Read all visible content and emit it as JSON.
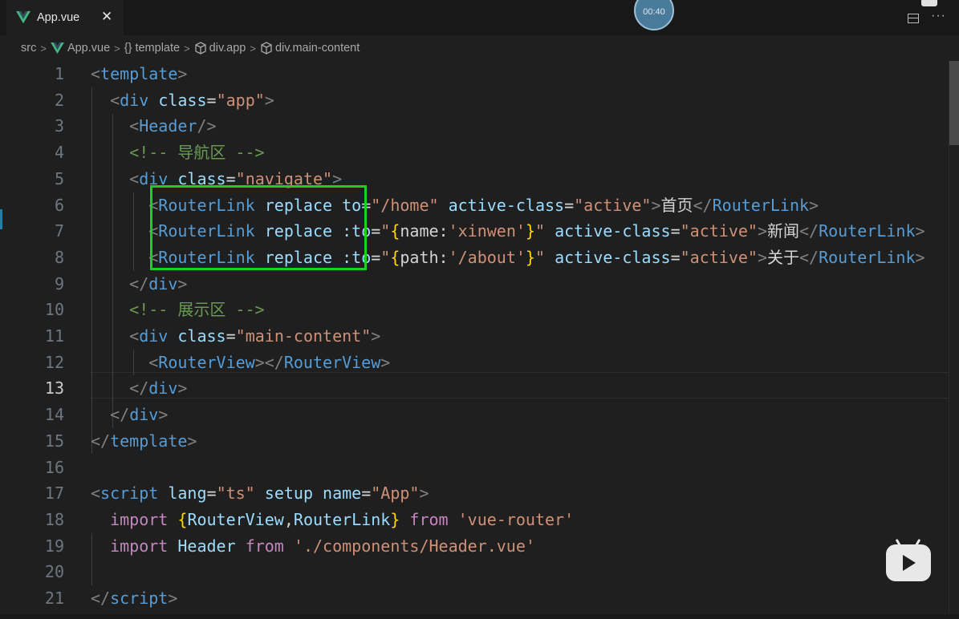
{
  "tab": {
    "file_name": "App.vue",
    "close_glyph": "✕"
  },
  "timer": "00:40",
  "breadcrumb": [
    "src",
    "App.vue",
    "{} template",
    "div.app",
    "div.main-content"
  ],
  "lines": [
    {
      "n": "1",
      "html": "<span class='pun'>&lt;</span><span class='tag'>template</span><span class='pun'>&gt;</span>"
    },
    {
      "n": "2",
      "html": "  <span class='pun'>&lt;</span><span class='tag'>div</span> <span class='attr'>class</span>=<span class='str'>\"app\"</span><span class='pun'>&gt;</span>"
    },
    {
      "n": "3",
      "html": "    <span class='pun'>&lt;</span><span class='tag'>Header</span><span class='pun'>/&gt;</span>"
    },
    {
      "n": "4",
      "html": "    <span class='cm'>&lt;!-- 导航区 --&gt;</span>"
    },
    {
      "n": "5",
      "html": "    <span class='pun'>&lt;</span><span class='tag'>div</span> <span class='attr'>class</span>=<span class='str'>\"navigate\"</span><span class='pun'>&gt;</span>"
    },
    {
      "n": "6",
      "html": "      <span class='pun'>&lt;</span><span class='tag'>RouterLink</span> <span class='attr'>replace</span> <span class='attr'>to</span>=<span class='str'>\"/home\"</span> <span class='attr'>active-class</span>=<span class='str'>\"active\"</span><span class='pun'>&gt;</span>首页<span class='pun'>&lt;/</span><span class='tag'>RouterLink</span><span class='pun'>&gt;</span>"
    },
    {
      "n": "7",
      "html": "      <span class='pun'>&lt;</span><span class='tag'>RouterLink</span> <span class='attr'>replace</span> <span class='attr'>:to</span>=<span class='str'>\"</span><span class='br'>{</span><span class='txt'>name:</span><span class='str'>'xinwen'</span><span class='br'>}</span><span class='str'>\"</span> <span class='attr'>active-class</span>=<span class='str'>\"active\"</span><span class='pun'>&gt;</span>新闻<span class='pun'>&lt;/</span><span class='tag'>RouterLink</span><span class='pun'>&gt;</span>"
    },
    {
      "n": "8",
      "html": "      <span class='pun'>&lt;</span><span class='tag'>RouterLink</span> <span class='attr'>replace</span> <span class='attr'>:to</span>=<span class='str'>\"</span><span class='br'>{</span><span class='txt'>path:</span><span class='str'>'/about'</span><span class='br'>}</span><span class='str'>\"</span> <span class='attr'>active-class</span>=<span class='str'>\"active\"</span><span class='pun'>&gt;</span>关于<span class='pun'>&lt;/</span><span class='tag'>RouterLink</span><span class='pun'>&gt;</span>"
    },
    {
      "n": "9",
      "html": "    <span class='pun'>&lt;/</span><span class='tag'>div</span><span class='pun'>&gt;</span>"
    },
    {
      "n": "10",
      "html": "    <span class='cm'>&lt;!-- 展示区 --&gt;</span>"
    },
    {
      "n": "11",
      "html": "    <span class='pun'>&lt;</span><span class='tag'>div</span> <span class='attr'>class</span>=<span class='str'>\"main-content\"</span><span class='pun'>&gt;</span>"
    },
    {
      "n": "12",
      "html": "      <span class='pun'>&lt;</span><span class='tag'>RouterView</span><span class='pun'>&gt;&lt;/</span><span class='tag'>RouterView</span><span class='pun'>&gt;</span>"
    },
    {
      "n": "13",
      "html": "    <span class='pun'>&lt;/</span><span class='tag'>div</span><span class='pun'>&gt;</span>"
    },
    {
      "n": "14",
      "html": "  <span class='pun'>&lt;/</span><span class='tag'>div</span><span class='pun'>&gt;</span>"
    },
    {
      "n": "15",
      "html": "<span class='pun'>&lt;/</span><span class='tag'>template</span><span class='pun'>&gt;</span>"
    },
    {
      "n": "16",
      "html": ""
    },
    {
      "n": "17",
      "html": "<span class='pun'>&lt;</span><span class='tag'>script</span> <span class='attr'>lang</span>=<span class='str'>\"ts\"</span> <span class='attr'>setup</span> <span class='attr'>name</span>=<span class='str'>\"App\"</span><span class='pun'>&gt;</span>"
    },
    {
      "n": "18",
      "html": "  <span class='kw'>import</span> <span class='br'>{</span><span class='attr'>RouterView</span>,<span class='attr'>RouterLink</span><span class='br'>}</span> <span class='kw'>from</span> <span class='str'>'vue-router'</span>"
    },
    {
      "n": "19",
      "html": "  <span class='kw'>import</span> <span class='attr'>Header</span> <span class='kw'>from</span> <span class='str'>'./components/Header.vue'</span>"
    },
    {
      "n": "20",
      "html": ""
    },
    {
      "n": "21",
      "html": "<span class='pun'>&lt;/</span><span class='tag'>script</span><span class='pun'>&gt;</span>"
    }
  ],
  "active_line": "13",
  "colors": {
    "highlight_box": "#1fcf1f",
    "background": "#1f1f1f",
    "tag": "#569cd6",
    "string": "#ce9178",
    "attribute": "#9cdcfe",
    "comment": "#6a9955",
    "keyword": "#c586c0"
  }
}
